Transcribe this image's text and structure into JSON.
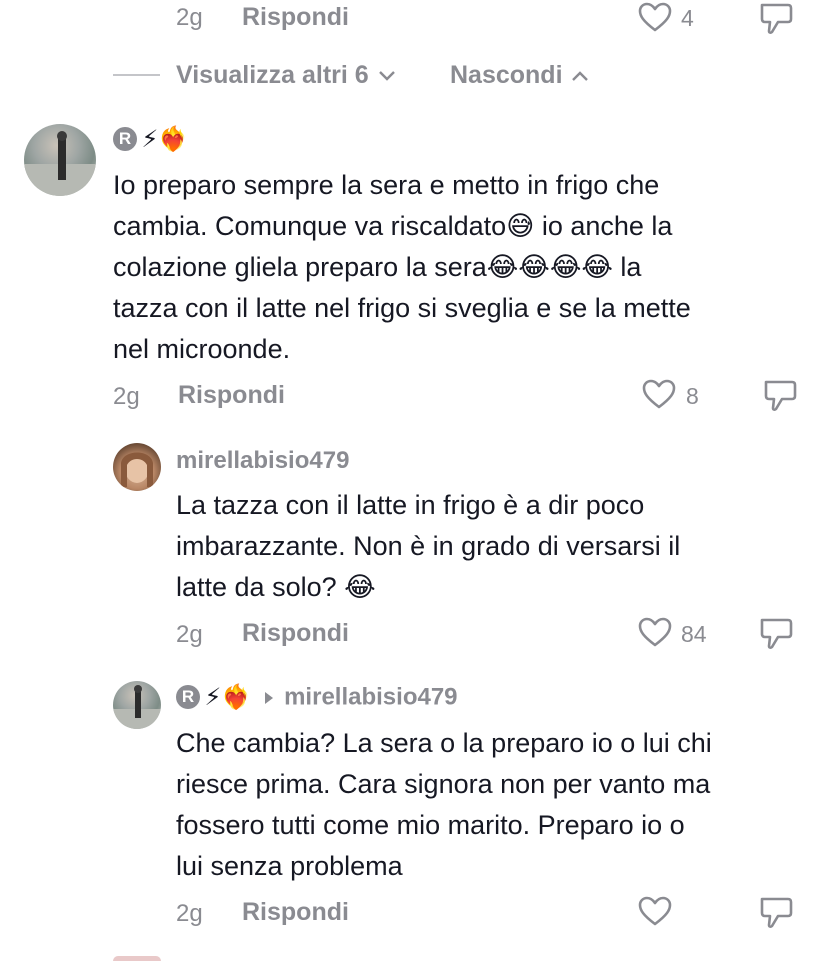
{
  "top_actions": {
    "time": "2g",
    "reply": "Rispondi",
    "likes": "4"
  },
  "thread_controls": {
    "view_more": "Visualizza altri 6",
    "hide": "Nascondi"
  },
  "comment_1": {
    "user_badge": "R",
    "user_emojis": "⚡❤️‍🔥",
    "line1": "Io preparo sempre la sera e metto in frigo che",
    "line2": "cambia. Comunque va riscaldato😅 io anche la",
    "line3": "colazione gliela preparo la sera😂😂😂😂 la",
    "line4": "tazza con il latte nel frigo si sveglia e se la mette",
    "line5": "nel microonde.",
    "time": "2g",
    "reply": "Rispondi",
    "likes": "8"
  },
  "reply_1": {
    "username": "mirellabisio479",
    "line1": "La tazza con il latte in frigo è a dir poco",
    "line2": "imbarazzante. Non è in grado di versarsi il",
    "line3": "latte da solo? 😂",
    "time": "2g",
    "reply": "Rispondi",
    "likes": "84"
  },
  "reply_2": {
    "user_badge": "R",
    "user_emojis": "⚡❤️‍🔥",
    "reply_to": "mirellabisio479",
    "line1": "Che cambia? La sera o la preparo io o lui chi",
    "line2": "riesce prima. Cara signora non per vanto ma",
    "line3": "fossero tutti come mio marito. Preparo io o",
    "line4": "lui senza problema",
    "time": "2g",
    "reply": "Rispondi"
  },
  "colors": {
    "text": "#161823",
    "muted": "#8a8b91",
    "background": "#ffffff"
  }
}
